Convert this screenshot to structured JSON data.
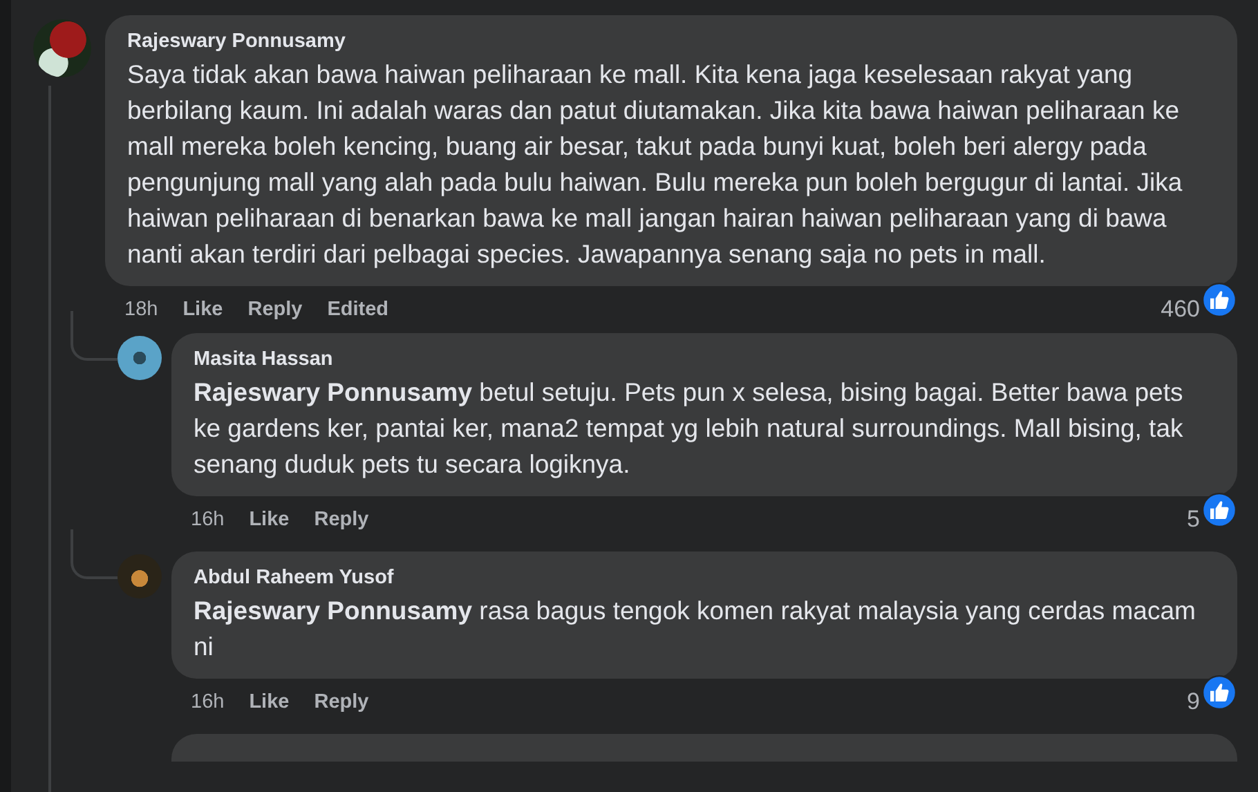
{
  "comment": {
    "author": "Rajeswary Ponnusamy",
    "text": "Saya tidak akan bawa haiwan peliharaan ke mall. Kita kena jaga keselesaan rakyat yang berbilang kaum. Ini adalah waras dan patut diutamakan. Jika kita bawa haiwan peliharaan ke mall mereka boleh kencing, buang air besar, takut pada bunyi kuat, boleh beri alergy pada pengunjung mall yang alah pada bulu haiwan. Bulu mereka pun boleh bergugur di lantai. Jika haiwan peliharaan di benarkan bawa ke mall jangan hairan haiwan peliharaan yang di bawa nanti akan terdiri dari pelbagai species. Jawapannya senang saja no pets in mall.",
    "time": "18h",
    "like": "Like",
    "reply": "Reply",
    "edited": "Edited",
    "reactions": "460",
    "replies": [
      {
        "author": "Masita Hassan",
        "text": "**Rajeswary Ponnusamy** betul setuju. Pets pun x selesa, bising bagai. Better bawa pets ke gardens ker, pantai ker, mana2 tempat yg lebih natural surroundings. Mall bising, tak senang duduk pets tu secara logiknya.",
        "time": "16h",
        "like": "Like",
        "reply": "Reply",
        "reactions": "5"
      },
      {
        "author": "Abdul Raheem Yusof",
        "text": "**Rajeswary Ponnusamy** rasa bagus tengok komen rakyat malaysia yang cerdas macam ni",
        "time": "16h",
        "like": "Like",
        "reply": "Reply",
        "reactions": "9"
      }
    ]
  }
}
